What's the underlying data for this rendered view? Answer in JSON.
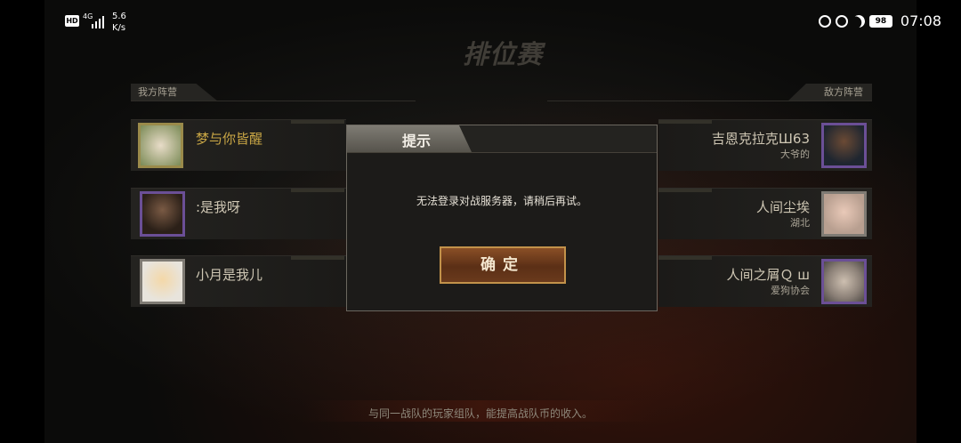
{
  "status_bar": {
    "hd": "HD",
    "network": "4G",
    "speed_value": "5.6",
    "speed_unit": "K/s",
    "battery": "98",
    "time": "07:08"
  },
  "screen": {
    "title": "排位赛",
    "my_team_label": "我方阵营",
    "enemy_team_label": "敌方阵营",
    "tip": "与同一战队的玩家组队，能提高战队币的收入。"
  },
  "my_team": [
    {
      "name": "梦与你皆醒",
      "avatar_icon": "white-pet-avatar-icon"
    },
    {
      "name": ":是我呀",
      "avatar_icon": "soldier-avatar-icon"
    },
    {
      "name": "小月是我儿",
      "avatar_icon": "cartoon-pig-avatar-icon"
    }
  ],
  "enemy_team": [
    {
      "name": "吉恩克拉克Ш63",
      "sub": "大爷的",
      "avatar_icon": "soldier-avatar-icon"
    },
    {
      "name": "人间尘埃",
      "sub": "湖北",
      "avatar_icon": "girl-avatar-icon"
    },
    {
      "name": "人间之屑Ｑ ш",
      "sub": "爱狗协会",
      "avatar_icon": "coin-avatar-icon"
    }
  ],
  "dialog": {
    "title": "提示",
    "message": "无法登录对战服务器，请稍后再试。",
    "ok_label": "确定"
  },
  "colors": {
    "accent_gold": "#c9a645",
    "button_brown": "#8a4f26",
    "avatar_purple": "#6b4f96"
  }
}
